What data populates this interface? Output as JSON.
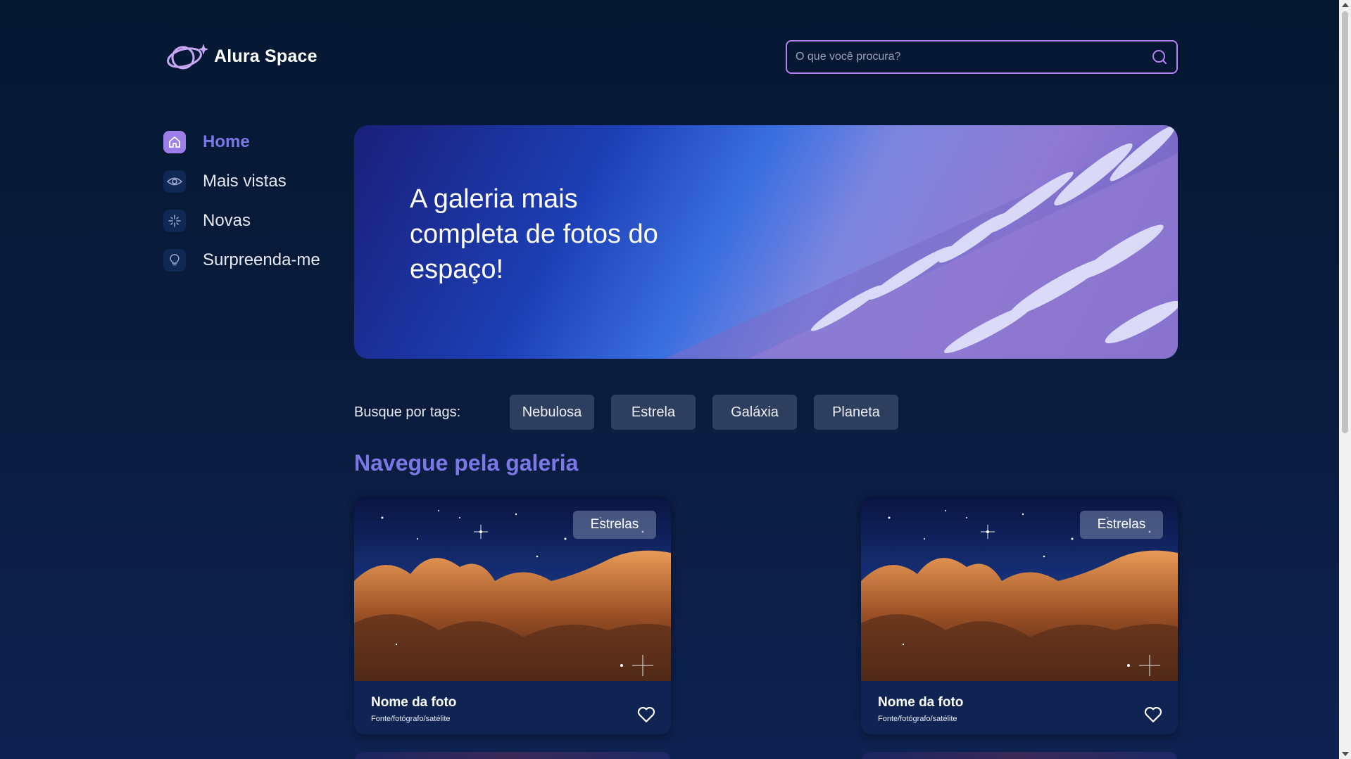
{
  "header": {
    "logo_text": "Alura Space",
    "search_placeholder": "O que você procura?"
  },
  "sidebar": {
    "items": [
      {
        "label": "Home",
        "icon": "home-icon",
        "active": true
      },
      {
        "label": "Mais vistas",
        "icon": "eye-icon",
        "active": false
      },
      {
        "label": "Novas",
        "icon": "sparkle-icon",
        "active": false
      },
      {
        "label": "Surpreenda-me",
        "icon": "lightbulb-icon",
        "active": false
      }
    ]
  },
  "banner": {
    "title": "A galeria mais completa de fotos do espaço!"
  },
  "tags": {
    "label": "Busque por tags:",
    "items": [
      "Nebulosa",
      "Estrela",
      "Galáxia",
      "Planeta"
    ]
  },
  "gallery": {
    "title": "Navegue pela galeria",
    "cards": [
      {
        "tag": "Estrelas",
        "title": "Nome da foto",
        "source": "Fonte/fotógrafo/satélite"
      },
      {
        "tag": "Estrelas",
        "title": "Nome da foto",
        "source": "Fonte/fotógrafo/satélite"
      }
    ]
  },
  "colors": {
    "accent": "#7b78e5",
    "search_border": "#b680f0",
    "tag_bg": "#2e3e5f",
    "background_top": "#041832",
    "card_bg": "#0f2453"
  }
}
